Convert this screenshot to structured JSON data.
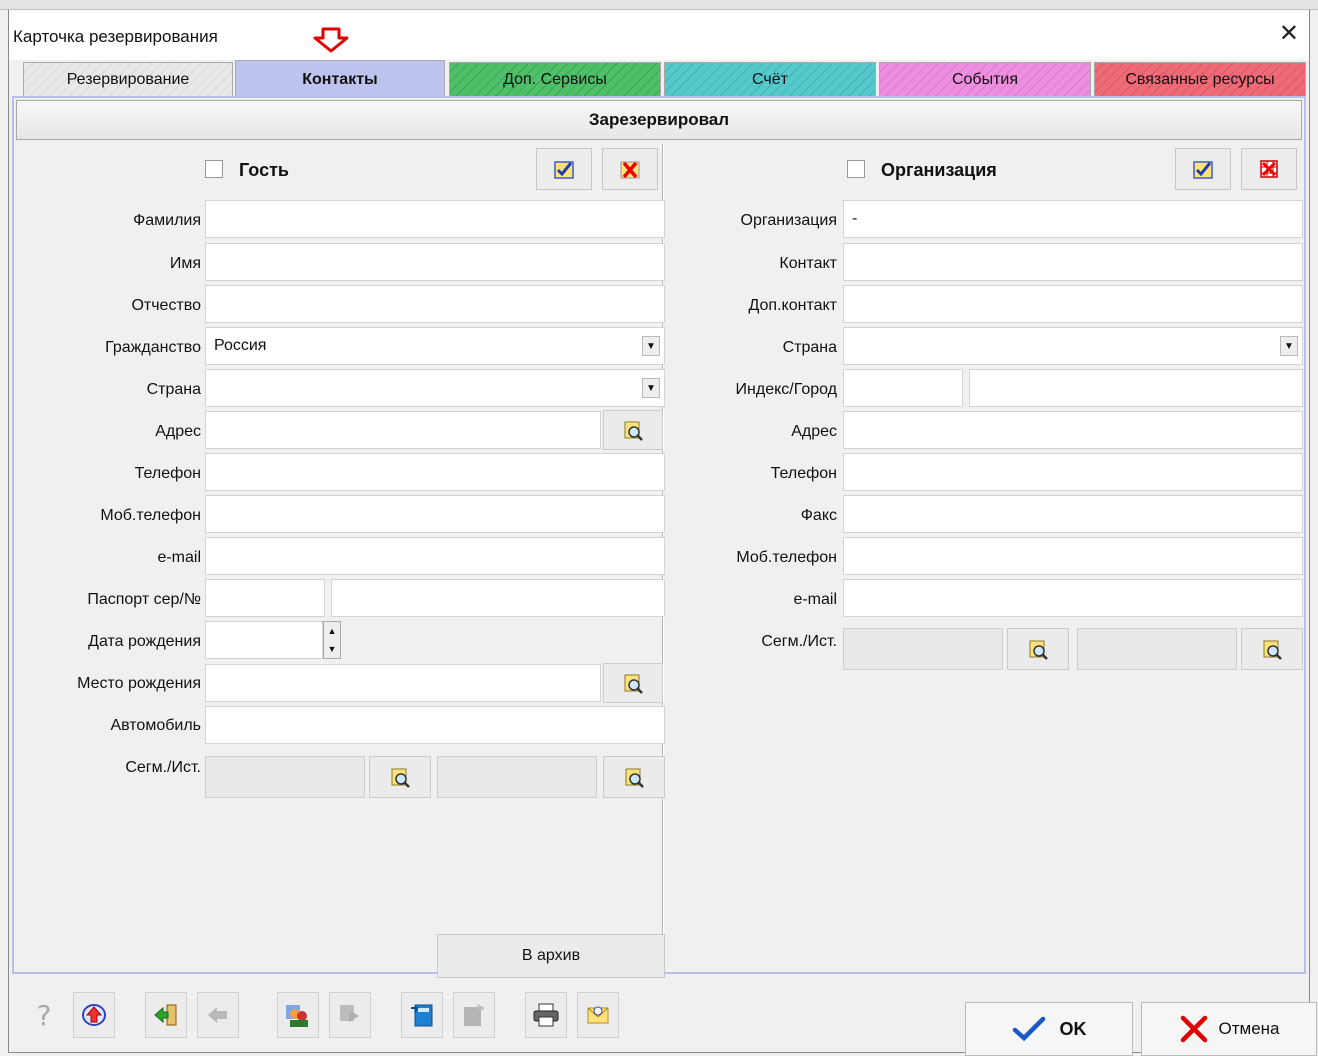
{
  "window": {
    "title": "Карточка резервирования"
  },
  "tabs": [
    {
      "label": "Резервирование",
      "color": "#e6e6e6"
    },
    {
      "label": "Контакты",
      "color": "#bcc3ee"
    },
    {
      "label": "Доп. Сервисы",
      "color": "#4fc06a"
    },
    {
      "label": "Счёт",
      "color": "#56c9cc"
    },
    {
      "label": "События",
      "color": "#ef8fe0"
    },
    {
      "label": "Связанные ресурсы",
      "color": "#ef6b78"
    }
  ],
  "section_header": "Зарезервировал",
  "guest": {
    "title": "Гость",
    "labels": {
      "surname": "Фамилия",
      "name": "Имя",
      "patronymic": "Отчество",
      "citizenship": "Гражданство",
      "country": "Страна",
      "address": "Адрес",
      "phone": "Телефон",
      "mobile": "Моб.телефон",
      "email": "e-mail",
      "passport": "Паспорт сер/№",
      "birthdate": "Дата рождения",
      "birthplace": "Место рождения",
      "car": "Автомобиль",
      "segment": "Сегм./Ист."
    },
    "values": {
      "citizenship": "Россия"
    }
  },
  "organization": {
    "title": "Организация",
    "labels": {
      "organization": "Организация",
      "contact": "Контакт",
      "extra_contact": "Доп.контакт",
      "country": "Страна",
      "zip_city": "Индекс/Город",
      "address": "Адрес",
      "phone": "Телефон",
      "fax": "Факс",
      "mobile": "Моб.телефон",
      "email": "e-mail",
      "segment": "Сегм./Ист."
    },
    "values": {
      "organization": "-"
    }
  },
  "archive_button": "В архив",
  "toolbar": {
    "help": "?",
    "icons": [
      "upload-icon",
      "enter-icon",
      "back-icon",
      "people-icon",
      "copy-icon",
      "calculator-icon",
      "paste-icon",
      "printer-icon",
      "mail-icon"
    ]
  },
  "ok_label": "OK",
  "cancel_label": "Отмена"
}
